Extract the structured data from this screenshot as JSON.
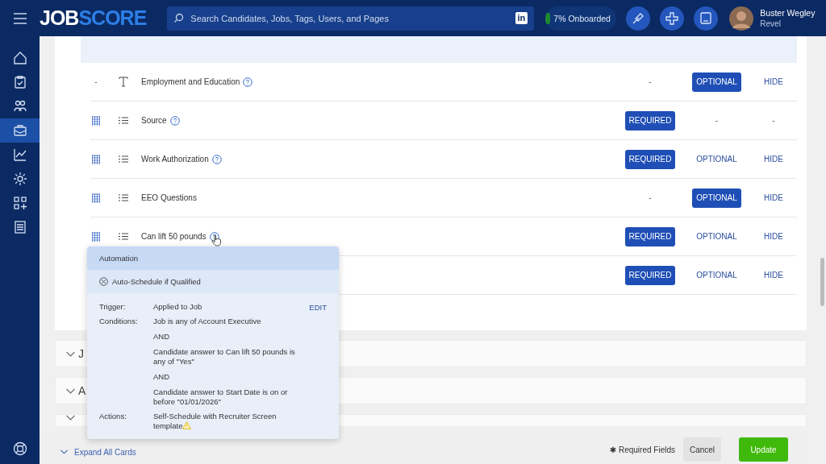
{
  "header": {
    "logo": {
      "part1": "JOB",
      "part2": "SCORE"
    },
    "search": {
      "placeholder": "Search Candidates, Jobs, Tags, Users, and Pages"
    },
    "linkedin": "in",
    "onboarding": {
      "label": "7% Onboarded",
      "level": 0.07
    },
    "user": {
      "name": "Buster Wegley",
      "org": "Revel"
    }
  },
  "sidebar": {
    "items": [
      {
        "selected": false
      },
      {
        "selected": false
      },
      {
        "selected": false
      },
      {
        "selected": true
      },
      {
        "selected": false
      },
      {
        "selected": false
      },
      {
        "selected": false
      },
      {
        "selected": false
      }
    ]
  },
  "rows": [
    {
      "handle": {
        "kind": "text",
        "text": "-"
      },
      "kind": "text",
      "label": "Employment and Education",
      "help": true,
      "hovered": false,
      "options": [
        {
          "kind": "none",
          "label": "-"
        },
        {
          "kind": "choice",
          "label": "OPTIONAL",
          "selected": true
        },
        {
          "kind": "choice",
          "label": "HIDE",
          "selected": false
        }
      ]
    },
    {
      "handle": {
        "kind": "grip"
      },
      "kind": "list",
      "label": "Source",
      "help": true,
      "hovered": false,
      "options": [
        {
          "kind": "choice",
          "label": "REQUIRED",
          "selected": true
        },
        {
          "kind": "none",
          "label": "-"
        },
        {
          "kind": "none",
          "label": "-"
        }
      ]
    },
    {
      "handle": {
        "kind": "grip"
      },
      "kind": "list",
      "label": "Work Authorization",
      "help": true,
      "hovered": false,
      "options": [
        {
          "kind": "choice",
          "label": "REQUIRED",
          "selected": true
        },
        {
          "kind": "choice",
          "label": "OPTIONAL",
          "selected": false
        },
        {
          "kind": "choice",
          "label": "HIDE",
          "selected": false
        }
      ]
    },
    {
      "handle": {
        "kind": "grip"
      },
      "kind": "list",
      "label": "EEO Questions",
      "help": false,
      "hovered": false,
      "options": [
        {
          "kind": "none",
          "label": "-"
        },
        {
          "kind": "choice",
          "label": "OPTIONAL",
          "selected": true
        },
        {
          "kind": "choice",
          "label": "HIDE",
          "selected": false
        }
      ]
    },
    {
      "handle": {
        "kind": "grip"
      },
      "kind": "list",
      "label": "Can lift 50 pounds",
      "help": true,
      "hovered": true,
      "options": [
        {
          "kind": "choice",
          "label": "REQUIRED",
          "selected": true
        },
        {
          "kind": "choice",
          "label": "OPTIONAL",
          "selected": false
        },
        {
          "kind": "choice",
          "label": "HIDE",
          "selected": false
        }
      ]
    },
    {
      "hovered": false,
      "options": [
        {
          "kind": "choice",
          "label": "REQUIRED",
          "selected": true
        },
        {
          "kind": "choice",
          "label": "OPTIONAL",
          "selected": false
        },
        {
          "kind": "choice",
          "label": "HIDE",
          "selected": false
        }
      ]
    }
  ],
  "cards": [
    {
      "title": "J",
      "expanded": false
    },
    {
      "title": "A",
      "expanded": false
    },
    {
      "expanded": false
    }
  ],
  "popover": {
    "title": "Automation",
    "rule": "Auto-Schedule if Qualified",
    "edit": "EDIT",
    "sections": [
      {
        "label": "Trigger:",
        "lines": [
          "Applied to Job"
        ],
        "warning": false
      },
      {
        "label": "Conditions:",
        "lines": [
          "Job is any of Account Executive",
          "AND",
          "Candidate answer to Can lift 50 pounds is any of \"Yes\"",
          "AND",
          "Candidate answer to Start Date is on or before \"01/01/2026\""
        ],
        "warning": false
      },
      {
        "label": "Actions:",
        "lines": [
          "Self-Schedule with Recruiter Screen template"
        ],
        "warning": true
      }
    ]
  },
  "footer": {
    "expand_all": "Expand All Cards",
    "required_mark": "✱",
    "required_note": "Required Fields",
    "cancel": "Cancel",
    "update": "Update"
  }
}
